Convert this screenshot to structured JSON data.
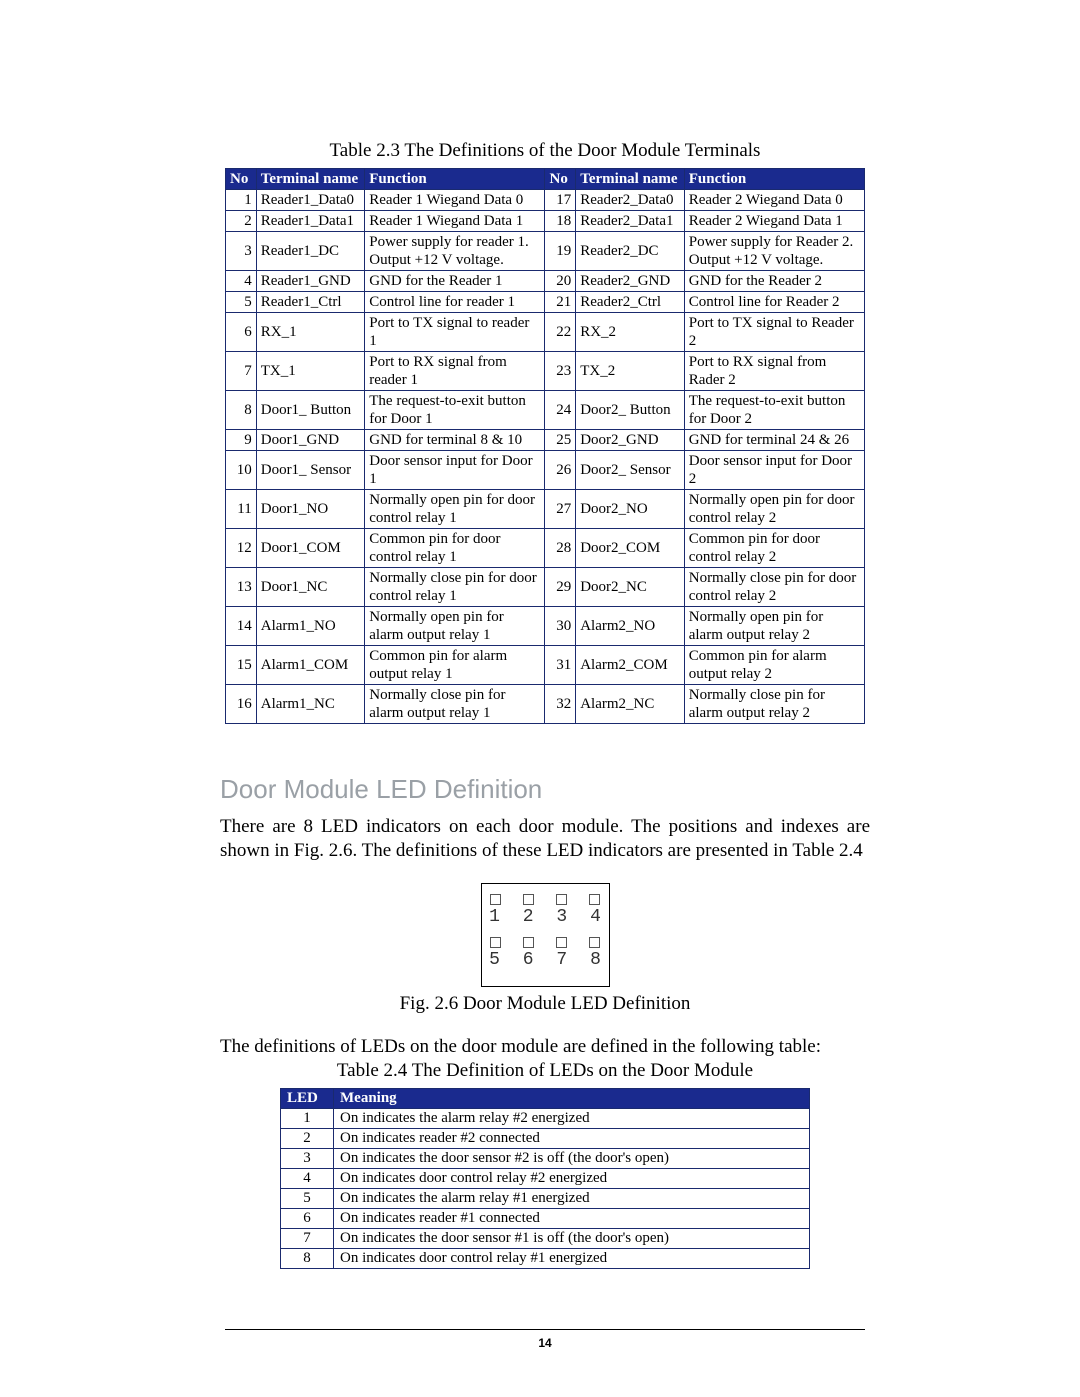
{
  "table1": {
    "caption": "Table 2.3 The Definitions of the Door Module Terminals",
    "headers": {
      "no": "No",
      "name": "Terminal name",
      "func": "Function"
    },
    "left": [
      {
        "no": "1",
        "name": "Reader1_Data0",
        "func": "Reader 1 Wiegand Data 0"
      },
      {
        "no": "2",
        "name": "Reader1_Data1",
        "func": "Reader 1 Wiegand Data 1"
      },
      {
        "no": "3",
        "name": "Reader1_DC",
        "func": "Power supply for reader 1. Output +12 V voltage."
      },
      {
        "no": "4",
        "name": "Reader1_GND",
        "func": "GND for the Reader 1"
      },
      {
        "no": "5",
        "name": "Reader1_Ctrl",
        "func": "Control line for reader 1"
      },
      {
        "no": "6",
        "name": "RX_1",
        "func": "Port to TX signal to reader 1"
      },
      {
        "no": "7",
        "name": "TX_1",
        "func": "Port to RX signal from reader 1"
      },
      {
        "no": "8",
        "name": "Door1_ Button",
        "func": "The request-to-exit button for Door 1"
      },
      {
        "no": "9",
        "name": "Door1_GND",
        "func": "GND for terminal 8 & 10"
      },
      {
        "no": "10",
        "name": "Door1_ Sensor",
        "func": "Door sensor input for Door 1"
      },
      {
        "no": "11",
        "name": "Door1_NO",
        "func": "Normally open pin for door control relay 1"
      },
      {
        "no": "12",
        "name": "Door1_COM",
        "func": "Common pin for door control relay 1"
      },
      {
        "no": "13",
        "name": "Door1_NC",
        "func": "Normally close pin for door control relay 1"
      },
      {
        "no": "14",
        "name": "Alarm1_NO",
        "func": "Normally open pin for alarm output relay 1"
      },
      {
        "no": "15",
        "name": "Alarm1_COM",
        "func": "Common pin for alarm output relay 1"
      },
      {
        "no": "16",
        "name": "Alarm1_NC",
        "func": "Normally close pin for alarm output relay 1"
      }
    ],
    "right": [
      {
        "no": "17",
        "name": "Reader2_Data0",
        "func": "Reader 2 Wiegand Data 0"
      },
      {
        "no": "18",
        "name": "Reader2_Data1",
        "func": "Reader 2 Wiegand Data 1"
      },
      {
        "no": "19",
        "name": "Reader2_DC",
        "func": "Power supply for Reader 2. Output +12 V voltage."
      },
      {
        "no": "20",
        "name": "Reader2_GND",
        "func": "GND for the Reader 2"
      },
      {
        "no": "21",
        "name": "Reader2_Ctrl",
        "func": "Control line for Reader 2"
      },
      {
        "no": "22",
        "name": "RX_2",
        "func": "Port to TX signal to Reader 2"
      },
      {
        "no": "23",
        "name": "TX_2",
        "func": "Port to RX signal from Rader 2"
      },
      {
        "no": "24",
        "name": "Door2_ Button",
        "func": "The request-to-exit button for Door 2"
      },
      {
        "no": "25",
        "name": "Door2_GND",
        "func": "GND for terminal 24 & 26"
      },
      {
        "no": "26",
        "name": "Door2_ Sensor",
        "func": "Door sensor input for Door 2"
      },
      {
        "no": "27",
        "name": "Door2_NO",
        "func": "Normally open pin for door control relay 2"
      },
      {
        "no": "28",
        "name": "Door2_COM",
        "func": "Common pin for door control relay 2"
      },
      {
        "no": "29",
        "name": "Door2_NC",
        "func": "Normally close pin for door control relay 2"
      },
      {
        "no": "30",
        "name": "Alarm2_NO",
        "func": "Normally open pin for alarm output relay 2"
      },
      {
        "no": "31",
        "name": "Alarm2_COM",
        "func": "Common pin for alarm output relay 2"
      },
      {
        "no": "32",
        "name": "Alarm2_NC",
        "func": "Normally close pin for alarm output relay 2"
      }
    ]
  },
  "section_heading": "Door Module LED Definition",
  "para1": "There are 8 LED indicators on each door module.  The positions and indexes are shown in Fig. 2.6. The definitions of these LED indicators are presented in Table 2.4",
  "fig": {
    "caption": "Fig. 2.6 Door Module LED Definition",
    "top": [
      "1",
      "2",
      "3",
      "4"
    ],
    "bottom": [
      "5",
      "6",
      "7",
      "8"
    ]
  },
  "para2": "The definitions of LEDs on the door module are defined in the following table:",
  "table2": {
    "caption": "Table 2.4 The Definition of LEDs on the Door Module",
    "headers": {
      "led": "LED",
      "meaning": "Meaning"
    },
    "rows": [
      {
        "no": "1",
        "meaning": "On indicates the alarm relay #2 energized"
      },
      {
        "no": "2",
        "meaning": "On indicates reader #2 connected"
      },
      {
        "no": "3",
        "meaning": "On indicates the door sensor #2 is off (the door's open)"
      },
      {
        "no": "4",
        "meaning": "On indicates door control relay #2 energized"
      },
      {
        "no": "5",
        "meaning": "On indicates the alarm relay #1 energized"
      },
      {
        "no": "6",
        "meaning": "On indicates reader #1 connected"
      },
      {
        "no": "7",
        "meaning": "On indicates the door sensor #1 is off (the door's open)"
      },
      {
        "no": "8",
        "meaning": "On indicates door control relay #1 energized"
      }
    ]
  },
  "page_number": "14"
}
